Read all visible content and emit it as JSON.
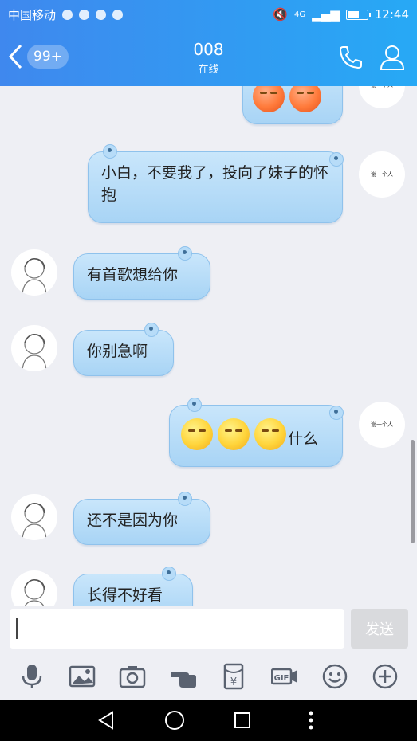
{
  "status_bar": {
    "carrier": "中国移动",
    "network": "4G",
    "time": "12:44"
  },
  "header": {
    "unread_badge": "99+",
    "title": "008",
    "subtitle": "在线"
  },
  "messages": [
    {
      "side": "right",
      "type": "emoji",
      "emojis": [
        "red",
        "red"
      ]
    },
    {
      "side": "right",
      "type": "text",
      "text": "小白，不要我了，投向了妹子的怀抱"
    },
    {
      "side": "left",
      "type": "text",
      "text": "有首歌想给你"
    },
    {
      "side": "left",
      "type": "text",
      "text": "你别急啊"
    },
    {
      "side": "right",
      "type": "emoji_text",
      "emojis": [
        "yellow",
        "yellow",
        "yellow"
      ],
      "text": "什么"
    },
    {
      "side": "left",
      "type": "text",
      "text": "还不是因为你"
    },
    {
      "side": "left",
      "type": "text",
      "text": "长得不好看"
    }
  ],
  "self_avatar_text": "谢一个人",
  "input": {
    "placeholder": "",
    "value": "",
    "send_label": "发送"
  },
  "toolbar": {
    "items": [
      "microphone-icon",
      "image-icon",
      "camera-icon",
      "red-packet-hand-icon",
      "red-envelope-icon",
      "gif-icon",
      "emoji-icon",
      "plus-icon"
    ],
    "gif_label": "GIF",
    "yen_label": "¥"
  },
  "colors": {
    "header_start": "#3f88ee",
    "header_end": "#27a9f5",
    "bubble": "#b7dcf8",
    "background": "#eeeff4"
  }
}
